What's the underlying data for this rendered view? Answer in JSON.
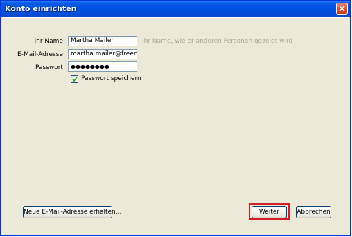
{
  "window": {
    "title": "Konto einrichten"
  },
  "form": {
    "name_label": "Ihr Name:",
    "name_value": "Martha Mailer",
    "name_hint": "Ihr Name, wie er anderen Personen gezeigt wird",
    "email_label": "E-Mail-Adresse:",
    "email_value": "martha.mailer@freenet.",
    "password_label": "Passwort:",
    "password_value": "●●●●●●●●",
    "save_password_label": "Passwort speichern",
    "save_password_checked": true
  },
  "buttons": {
    "new_address": "Neue E-Mail-Adresse erhalten...",
    "next": "Weiter",
    "cancel": "Abbrechen"
  },
  "colors": {
    "titlebar": "#0054e3",
    "dialog_bg": "#ece9d8",
    "highlight_outline": "#d21f26",
    "hint_text": "#aca899"
  },
  "icons": {
    "close": "close-icon",
    "checkbox": "checkmark-icon"
  }
}
